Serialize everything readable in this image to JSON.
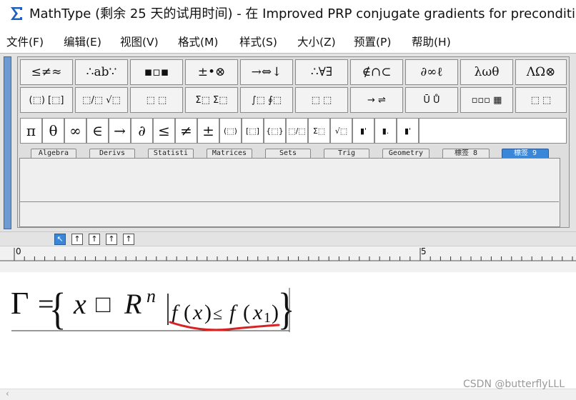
{
  "window": {
    "title": "MathType (剩余 25 天的试用时间) - 在 Improved PRP conjugate gradients for preconditioning",
    "icon": "mathtype-sigma-icon"
  },
  "menu": [
    "文件(F)",
    "编辑(E)",
    "视图(V)",
    "格式(M)",
    "样式(S)",
    "大小(Z)",
    "预置(P)",
    "帮助(H)"
  ],
  "palettes": {
    "row1": [
      "≤≠≈",
      "∴ab∵",
      "▪▫▪",
      "±•⊗",
      "→⇔↓",
      "∴∀∃",
      "∉∩⊂",
      "∂∞ℓ",
      "λωθ",
      "ΛΩ⊗"
    ],
    "row2": [
      "(⬚) [⬚]",
      "⬚/⬚ √⬚",
      "⬚ ⬚",
      "Σ⬚ Σ⬚",
      "∫⬚ ∮⬚",
      "⬚ ⬚",
      "→ ⇌",
      "Ū Ů",
      "▫▫▫ ▦",
      "⬚ ⬚"
    ]
  },
  "symbols": [
    "π",
    "θ",
    "∞",
    "∈",
    "→",
    "∂",
    "≤",
    "≠",
    "±",
    "(⬚)",
    "[⬚]",
    "{⬚}",
    "⬚/⬚",
    "Σ⬚",
    "√⬚",
    "▮'",
    "▮.",
    "▮'"
  ],
  "tabs": [
    {
      "label": "Algebra",
      "active": false
    },
    {
      "label": "Derivs",
      "active": false
    },
    {
      "label": "Statisti",
      "active": false
    },
    {
      "label": "Matrices",
      "active": false
    },
    {
      "label": "Sets",
      "active": false
    },
    {
      "label": "Trig",
      "active": false
    },
    {
      "label": "Geometry",
      "active": false
    },
    {
      "label": "標签 8",
      "active": false
    },
    {
      "label": "標签 9",
      "active": true
    }
  ],
  "small_toolbar": [
    "↖",
    "↑",
    "↑",
    "↑",
    "↑"
  ],
  "ruler": {
    "label_0": "0",
    "label_5": "5"
  },
  "formula": {
    "gamma": "Γ",
    "equals": "=",
    "lbrace": "{",
    "x": "x",
    "placeholder": "□",
    "R": "R",
    "n": "n",
    "f1": "f",
    "lp1": "(",
    "x_inner": "x",
    "rp1": ")",
    "leq": "≤",
    "f2": "f",
    "lp2": "(",
    "x2": "x",
    "sub1": "1",
    "rp2": ")",
    "rbrace": "}"
  },
  "colors": {
    "active_blue": "#3a86d8",
    "annotation_red": "#d62323",
    "grip_blue": "#6f9bd3"
  },
  "watermark": "CSDN @butterflyLLL"
}
